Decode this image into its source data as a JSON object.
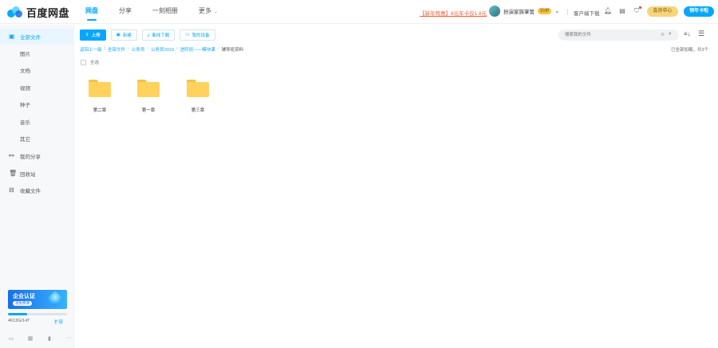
{
  "app": {
    "name": "百度网盘",
    "colors": {
      "accent": "#06a7ff",
      "folder": "#ffd25d",
      "promo": "#f25d3a"
    }
  },
  "nav": {
    "items": [
      {
        "label": "网盘"
      },
      {
        "label": "分享"
      },
      {
        "label": "一刻相册"
      },
      {
        "label": "更多"
      }
    ]
  },
  "header": {
    "promo": "【新年特惠】8元年卡仅1.8元",
    "username": "扮演家族掌管",
    "vip": "SVIP",
    "client_download": "客户端下载",
    "member_center": "会员中心",
    "new_button": "领年卡啦"
  },
  "sidebar": {
    "items": [
      {
        "label": "全部文件",
        "icon": "folder-icon"
      },
      {
        "label": "图片"
      },
      {
        "label": "文档"
      },
      {
        "label": "视频"
      },
      {
        "label": "种子"
      },
      {
        "label": "音乐"
      },
      {
        "label": "其它"
      },
      {
        "label": "我的分享",
        "icon": "share-icon"
      },
      {
        "label": "回收站",
        "icon": "trash-icon"
      },
      {
        "label": "收藏文件",
        "icon": "star-icon"
      }
    ],
    "banner_title": "企业认证",
    "banner_button": "领免费课",
    "quota": "4613G/14T",
    "quota_fraction": 0.33,
    "expand": "扩容"
  },
  "toolbar": {
    "upload": "上传",
    "new_folder": "新建",
    "offline_download": "离线下载",
    "my_devices": "我的设备"
  },
  "search": {
    "placeholder": "搜索我的文件"
  },
  "breadcrumb": {
    "items": [
      "返回上一级",
      "全部文件",
      "公务员",
      "公务员2019",
      "进阶班——模块课",
      "辅导班资料"
    ]
  },
  "list_status": "已全部加载，共3个",
  "select_all": "全选",
  "folders": [
    {
      "name": "第二章"
    },
    {
      "name": "第一章"
    },
    {
      "name": "第三章"
    }
  ]
}
